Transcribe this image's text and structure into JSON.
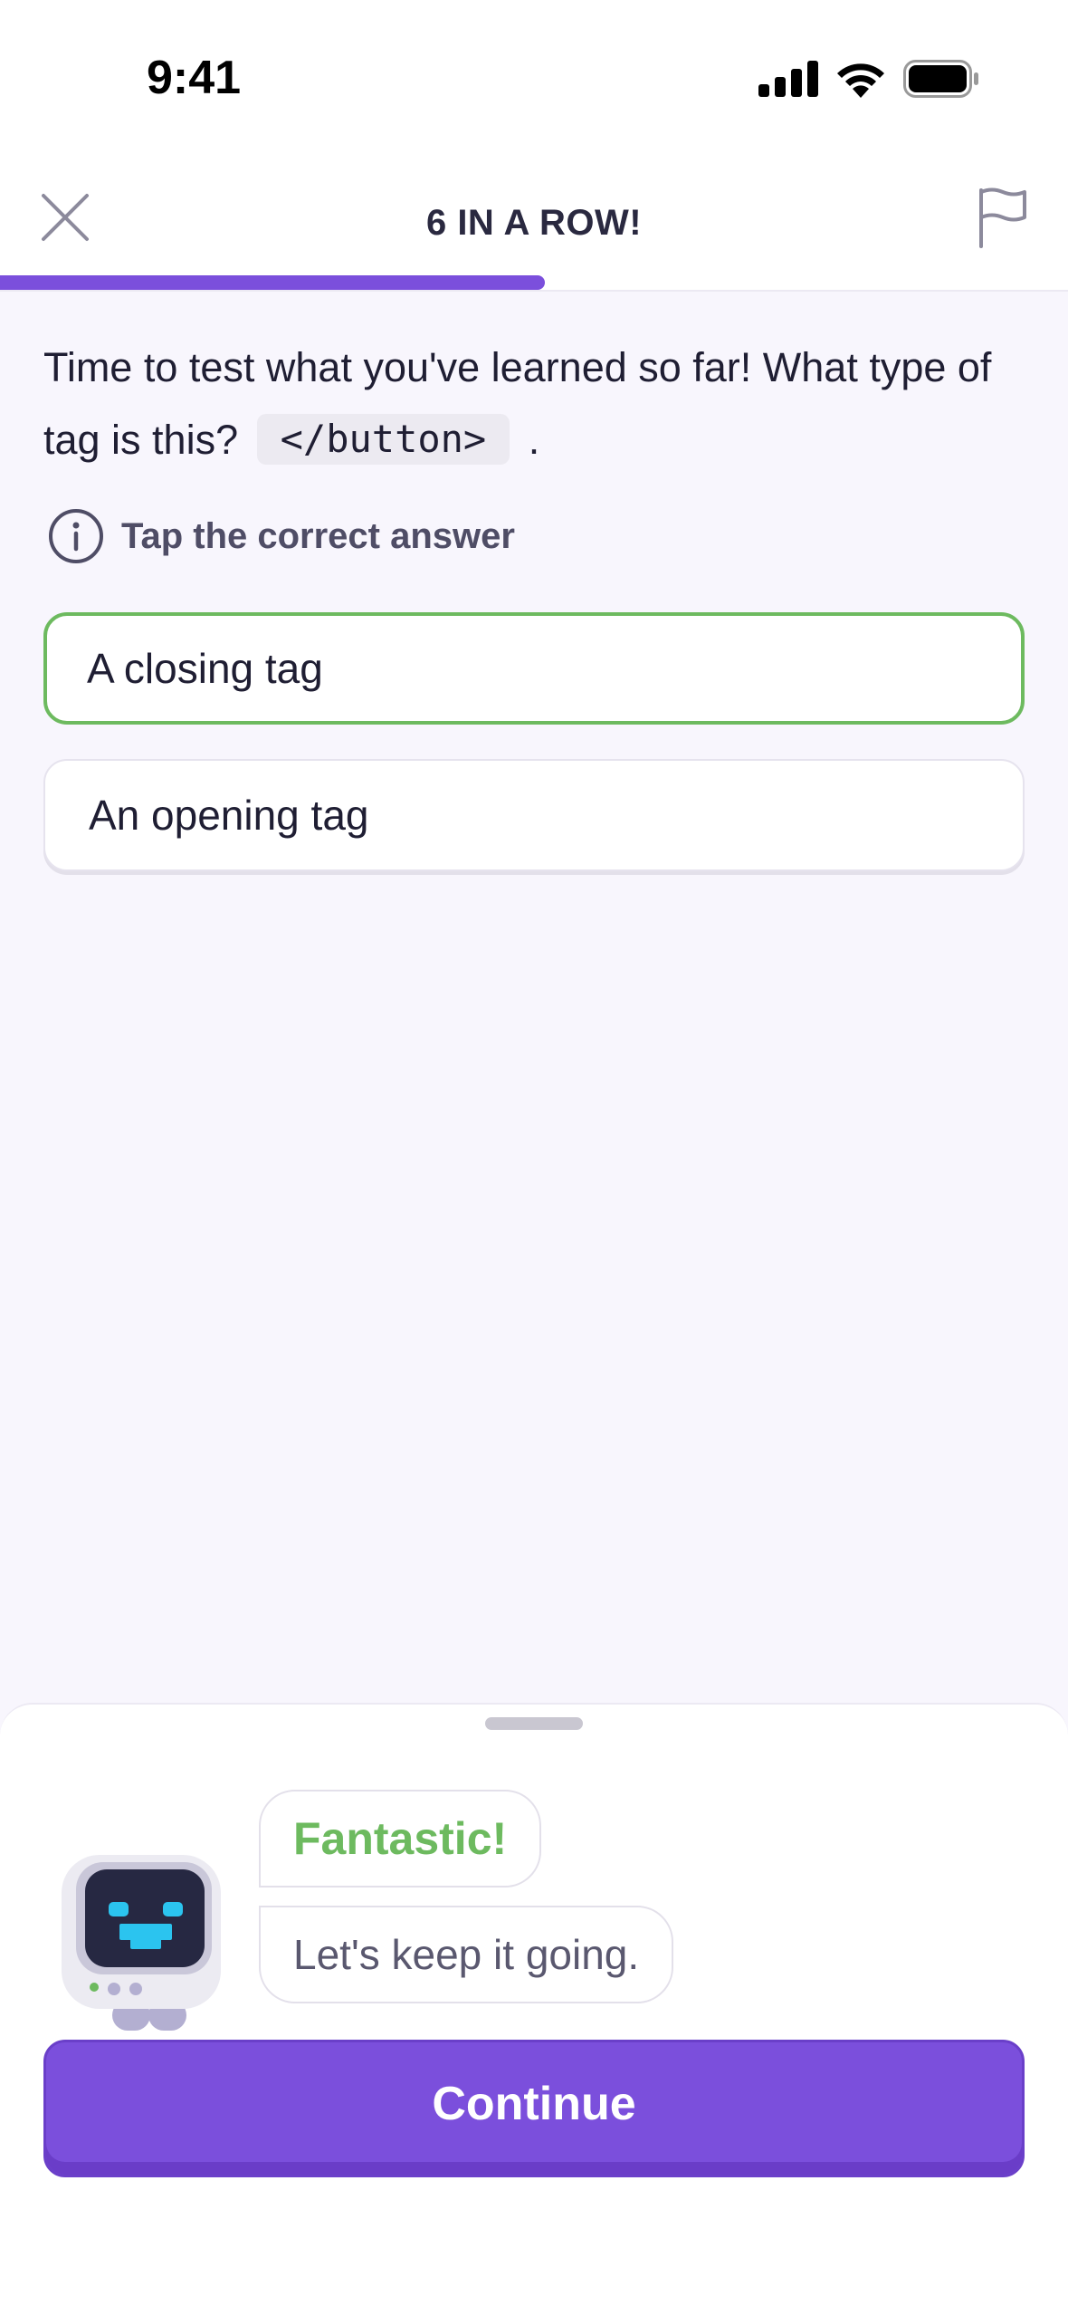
{
  "status_bar": {
    "time": "9:41"
  },
  "header": {
    "title": "6 IN A ROW!",
    "progress": 0.51
  },
  "question": {
    "text_before": "Time to test what you've learned so far! What type of tag is this?",
    "code": "</button>",
    "text_after": "."
  },
  "hint": {
    "text": "Tap the correct answer"
  },
  "answers": [
    {
      "label": "A closing tag",
      "state": "correct"
    },
    {
      "label": "An opening tag",
      "state": "default"
    }
  ],
  "feedback": {
    "headline": "Fantastic!",
    "message": "Let's keep it going."
  },
  "continue_label": "Continue",
  "colors": {
    "accent": "#7b4fdc",
    "correct": "#6dba5f",
    "background": "#f8f6fd"
  }
}
